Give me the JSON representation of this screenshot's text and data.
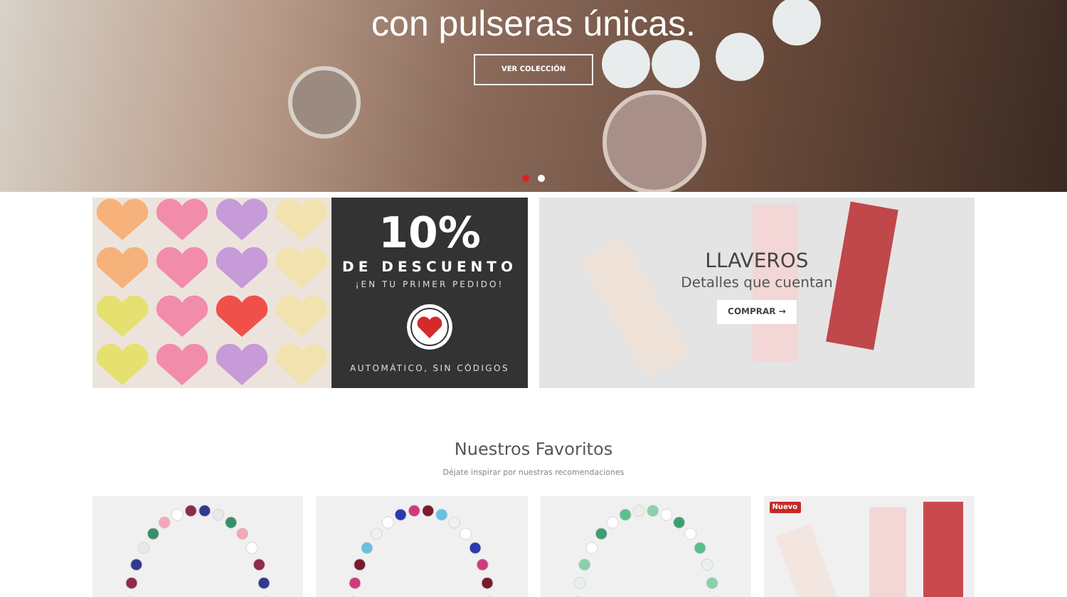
{
  "hero": {
    "title": "con pulseras únicas.",
    "button": "VER COLECCIÓN",
    "slides": [
      {
        "selected": true
      },
      {
        "selected": false
      }
    ]
  },
  "promo_banners": [
    {
      "kind": "discount",
      "big": "10%",
      "headline": "DE DESCUENTO",
      "subline": "¡EN TU PRIMER PEDIDO!",
      "footer": "AUTOMÁTICO, SIN CÓDIGOS"
    },
    {
      "kind": "category",
      "title": "LLAVEROS",
      "subtitle": "Detalles que cuentan",
      "button": "COMPRAR →"
    }
  ],
  "favorites": {
    "title": "Nuestros Favoritos",
    "subtitle": "Déjate inspirar por nuestras recomendaciones",
    "products": [
      {
        "kind": "bracelet"
      },
      {
        "kind": "bracelet"
      },
      {
        "kind": "bracelet"
      },
      {
        "kind": "keychain",
        "badge": "Nuevo"
      }
    ]
  }
}
